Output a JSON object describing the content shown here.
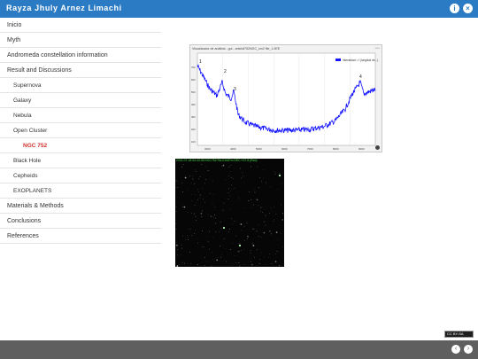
{
  "header": {
    "title": "Rayza Jhuly Arnez Limachi",
    "info_icon": "i",
    "close_icon": "×"
  },
  "sidebar": {
    "items": [
      {
        "label": "Inicio",
        "level": 0
      },
      {
        "label": "Myth",
        "level": 0
      },
      {
        "label": "Andromeda constellation information",
        "level": 0
      },
      {
        "label": "Result and Discussions",
        "level": 0
      },
      {
        "label": "Supernova",
        "level": 1
      },
      {
        "label": "Galaxy",
        "level": 1
      },
      {
        "label": "Nebula",
        "level": 1
      },
      {
        "label": "Open Cluster",
        "level": 1
      },
      {
        "label": "NGC 752",
        "level": 2,
        "active": true
      },
      {
        "label": "Black Hole",
        "level": 1
      },
      {
        "label": "Cepheids",
        "level": 1
      },
      {
        "label": "EXOPLANETS",
        "level": 1
      },
      {
        "label": "Materials & Methods",
        "level": 0
      },
      {
        "label": "Conclusions",
        "level": 0
      },
      {
        "label": "References",
        "level": 0
      }
    ]
  },
  "spectrum_figure": {
    "caption": "Visualizador de análisis - gui - arisfull752NGC_sm2 file_1.0EE",
    "legend": "intensidad = f (longitud de...)",
    "peak_labels": [
      "1",
      "2",
      "3",
      "4"
    ],
    "line_color": "#1414ff",
    "x_ticks": [
      "3000",
      "4000",
      "5000",
      "6000",
      "7000",
      "8000",
      "9000"
    ],
    "y_ticks": [
      "100",
      "200",
      "300",
      "400",
      "500",
      "600",
      "700"
    ]
  },
  "star_image": {
    "header": "2021-07-18 04:43:35 NGC752 RA:01h57m DEC:+37.8 (Red)"
  },
  "license_badge": "CC BY-SA",
  "footer": {
    "prev": "‹",
    "next": "›"
  },
  "colors": {
    "header_bg": "#2b7bc4",
    "active_item": "#d0312d",
    "footer_bg": "#5f5f5f"
  }
}
